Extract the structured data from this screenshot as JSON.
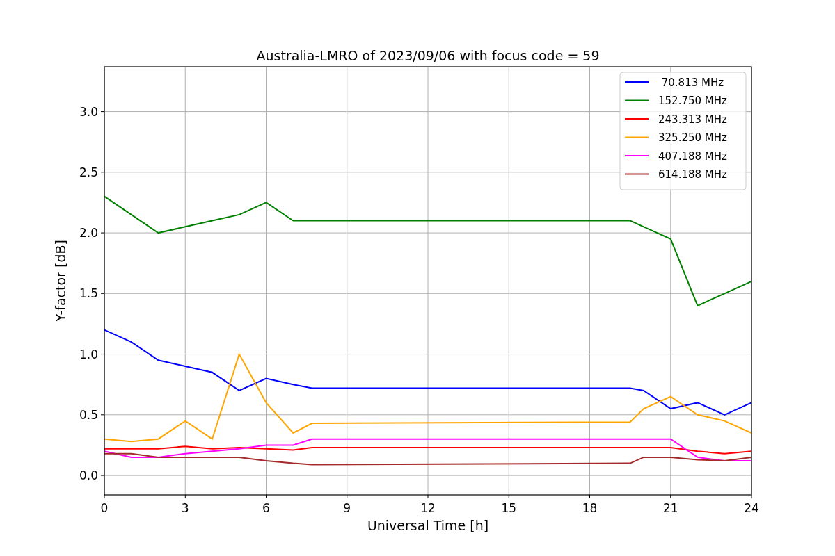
{
  "figure": {
    "chart_data": {
      "type": "line",
      "title": "Australia-LMRO of 2023/09/06 with focus code = 59",
      "xlabel": "Universal Time [h]",
      "ylabel": "Y-factor [dB]",
      "x": [
        0,
        1,
        2,
        3,
        4,
        5,
        6,
        7,
        7.7,
        19.5,
        20,
        21,
        22,
        23,
        24
      ],
      "series": [
        {
          "name": " 70.813 MHz",
          "color": "#0000ff",
          "values": [
            1.2,
            1.1,
            0.95,
            0.9,
            0.85,
            0.7,
            0.8,
            0.75,
            0.72,
            0.72,
            0.7,
            0.55,
            0.6,
            0.5,
            0.6
          ]
        },
        {
          "name": "152.750 MHz",
          "color": "#008000",
          "values": [
            2.3,
            2.15,
            2.0,
            2.05,
            2.1,
            2.15,
            2.25,
            2.1,
            2.1,
            2.1,
            2.05,
            1.95,
            1.4,
            1.5,
            1.6
          ]
        },
        {
          "name": "243.313 MHz",
          "color": "#ff0000",
          "values": [
            0.22,
            0.22,
            0.22,
            0.24,
            0.22,
            0.23,
            0.22,
            0.21,
            0.23,
            0.23,
            0.23,
            0.23,
            0.2,
            0.18,
            0.2
          ]
        },
        {
          "name": "325.250 MHz",
          "color": "#ffa500",
          "values": [
            0.3,
            0.28,
            0.3,
            0.45,
            0.3,
            1.0,
            0.6,
            0.35,
            0.43,
            0.44,
            0.55,
            0.65,
            0.5,
            0.45,
            0.35
          ]
        },
        {
          "name": "407.188 MHz",
          "color": "#ff00ff",
          "values": [
            0.2,
            0.15,
            0.15,
            0.18,
            0.2,
            0.22,
            0.25,
            0.25,
            0.3,
            0.3,
            0.3,
            0.3,
            0.15,
            0.12,
            0.12
          ]
        },
        {
          "name": "614.188 MHz",
          "color": "#a52a2a",
          "values": [
            0.18,
            0.18,
            0.15,
            0.15,
            0.15,
            0.15,
            0.12,
            0.1,
            0.09,
            0.1,
            0.15,
            0.15,
            0.13,
            0.12,
            0.15
          ]
        }
      ],
      "grid": true,
      "legend": true,
      "xlim": [
        0,
        24
      ],
      "ylim": [
        -0.16,
        3.37
      ],
      "xticks": [
        0,
        3,
        6,
        9,
        12,
        15,
        18,
        21,
        24
      ],
      "yticks": [
        {
          "value": 0,
          "label": "0.0"
        },
        {
          "value": 0.5,
          "label": "0.5"
        },
        {
          "value": 1,
          "label": "1.0"
        },
        {
          "value": 1.5,
          "label": "1.5"
        },
        {
          "value": 2,
          "label": "2.0"
        },
        {
          "value": 2.5,
          "label": "2.5"
        },
        {
          "value": 3,
          "label": "3.0"
        }
      ]
    }
  }
}
